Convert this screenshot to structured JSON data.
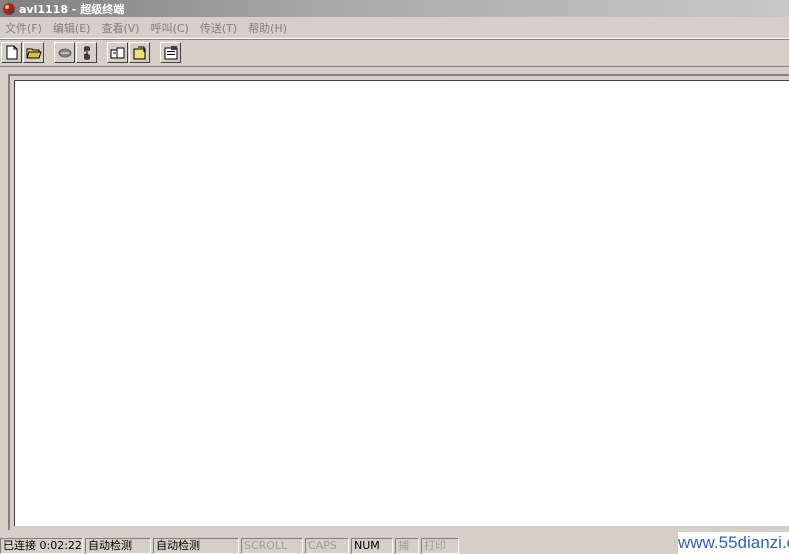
{
  "window": {
    "title": "avl1118 - 超级终端"
  },
  "menu": [
    {
      "label": "文件(F)"
    },
    {
      "label": "编辑(E)"
    },
    {
      "label": "查看(V)"
    },
    {
      "label": "呼叫(C)"
    },
    {
      "label": "传送(T)"
    },
    {
      "label": "帮助(H)"
    }
  ],
  "toolbar": [
    {
      "icon": "new-document-icon"
    },
    {
      "icon": "open-folder-icon"
    },
    {
      "icon": "disconnect-icon"
    },
    {
      "icon": "connect-icon"
    },
    {
      "icon": "send-file-icon"
    },
    {
      "icon": "receive-file-icon"
    },
    {
      "icon": "properties-icon"
    }
  ],
  "status": {
    "connection": "已连接 0:02:22",
    "detect1": "自动检测",
    "detect2": "自动检测",
    "scroll": "SCROLL",
    "caps": "CAPS",
    "num": "NUM",
    "capture": "捕",
    "print": "打印"
  },
  "watermark": "www.55dianzi.com",
  "colors": {
    "titlebar_start": "#808080",
    "face": "#d4d0c8",
    "watermark": "#2a62c8"
  }
}
